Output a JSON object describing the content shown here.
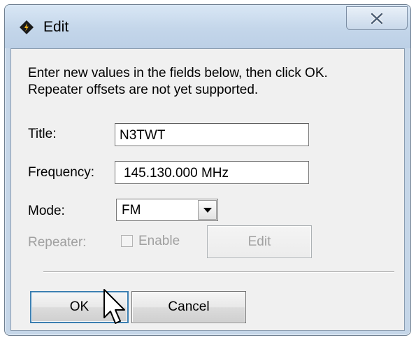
{
  "window": {
    "title": "Edit"
  },
  "instructions": {
    "line1": "Enter new values in the fields below, then click OK.",
    "line2": "Repeater offsets are not yet supported."
  },
  "fields": {
    "title": {
      "label": "Title:",
      "value": "N3TWT"
    },
    "frequency": {
      "label": "Frequency:",
      "value": "145.130.000 MHz"
    },
    "mode": {
      "label": "Mode:",
      "value": "FM"
    },
    "repeater": {
      "label": "Repeater:",
      "enable_label": "Enable",
      "enabled": false,
      "edit_label": "Edit"
    }
  },
  "buttons": {
    "ok": "OK",
    "cancel": "Cancel"
  },
  "colors": {
    "titlebar": "#c4d6ea",
    "client": "#f0f0f0",
    "disabled_text": "#a0a0a0",
    "default_button_border": "#3c7fb1"
  }
}
